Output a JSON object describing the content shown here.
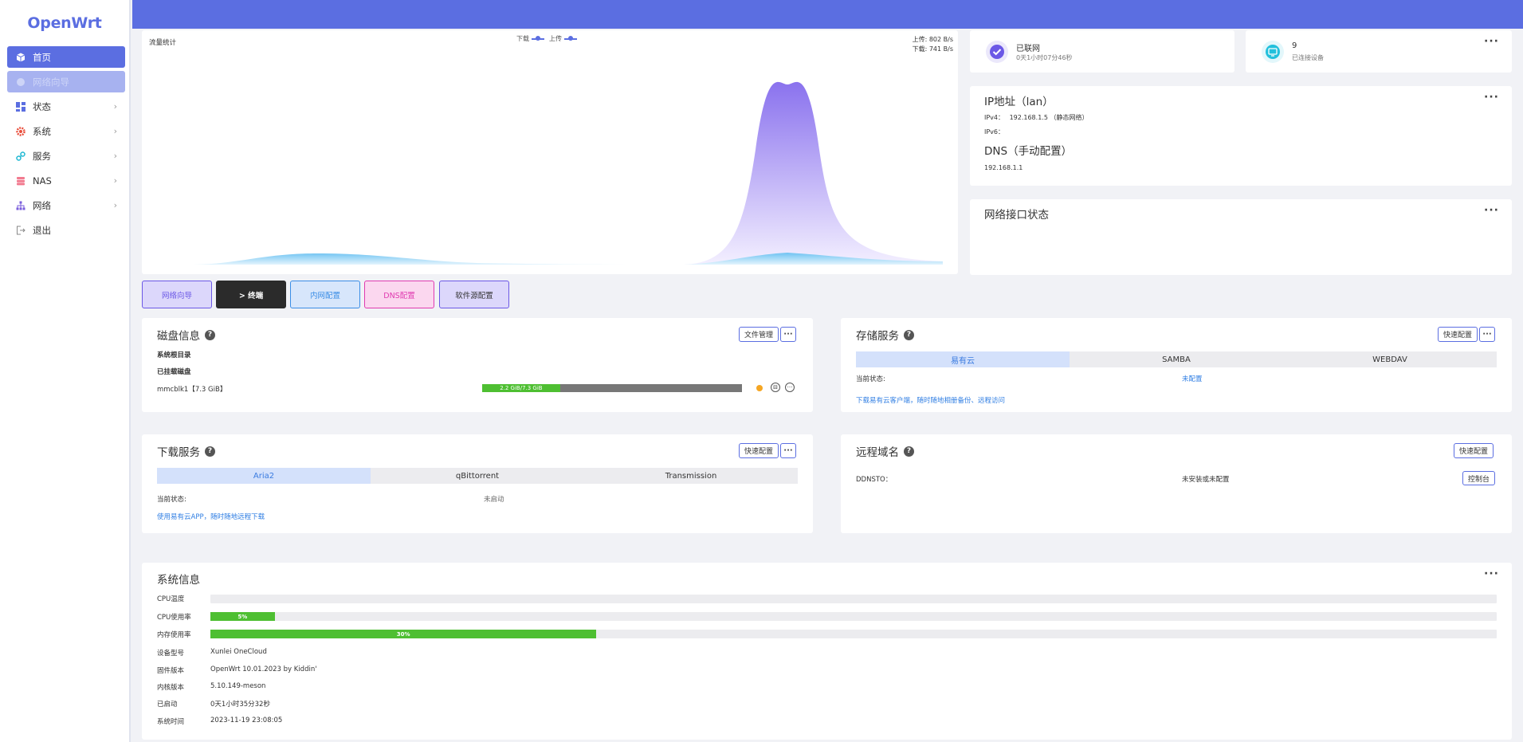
{
  "brand": "OpenWrt",
  "sidebar": {
    "items": [
      {
        "label": "首页",
        "icon": "cube-icon"
      },
      {
        "label": "网络向导",
        "icon": "wizard-icon"
      },
      {
        "label": "状态",
        "icon": "dashboard-icon"
      },
      {
        "label": "系统",
        "icon": "gear-icon"
      },
      {
        "label": "服务",
        "icon": "link-icon"
      },
      {
        "label": "NAS",
        "icon": "database-icon"
      },
      {
        "label": "网络",
        "icon": "network-icon"
      },
      {
        "label": "退出",
        "icon": "logout-icon"
      }
    ]
  },
  "traffic": {
    "title": "流量统计",
    "legend_down": "下载",
    "legend_up": "上传",
    "upload_rate": "上传: 802 B/s",
    "download_rate": "下载: 741 B/s"
  },
  "network_status": {
    "label": "已联网",
    "uptime": "0天1小时07分46秒"
  },
  "devices": {
    "count": "9",
    "label": "已连接设备"
  },
  "ip": {
    "title": "IP地址（lan）",
    "ipv4_label": "IPv4：",
    "ipv4_value": "192.168.1.5 （静态网络）",
    "ipv6_label": "IPv6：",
    "dns_title": "DNS（手动配置）",
    "dns_value": "192.168.1.1"
  },
  "interfaces": {
    "title": "网络接口状态"
  },
  "quick_buttons": [
    "网络向导",
    "> 终端",
    "内网配置",
    "DNS配置",
    "软件源配置"
  ],
  "disk": {
    "title": "磁盘信息",
    "file_btn": "文件管理",
    "sys_root": "系统根目录",
    "mounted": "已挂载磁盘",
    "device": "mmcblk1【7.3 GiB】",
    "usage_text": "2.2 GiB/7.3 GiB",
    "usage_fraction": 0.3
  },
  "storage": {
    "title": "存储服务",
    "quick_btn": "快速配置",
    "tabs": [
      "易有云",
      "SAMBA",
      "WEBDAV"
    ],
    "status_label": "当前状态:",
    "status_value": "未配置",
    "link": "下载易有云客户端，随时随地相册备份、远程访问"
  },
  "download": {
    "title": "下载服务",
    "quick_btn": "快速配置",
    "tabs": [
      "Aria2",
      "qBittorrent",
      "Transmission"
    ],
    "status_label": "当前状态:",
    "status_value": "未启动",
    "link": "使用易有云APP，随时随地远程下载"
  },
  "remote": {
    "title": "远程域名",
    "quick_btn": "快速配置",
    "ddnsto_label": "DDNSTO：",
    "ddnsto_value": "未安装或未配置",
    "console_btn": "控制台"
  },
  "system": {
    "title": "系统信息",
    "cpu_temp_label": "CPU温度",
    "cpu_usage_label": "CPU使用率",
    "cpu_usage": "5%",
    "cpu_usage_pct": 5,
    "mem_usage_label": "内存使用率",
    "mem_usage": "30%",
    "mem_usage_pct": 30,
    "model_label": "设备型号",
    "model": "Xunlei OneCloud",
    "firmware_label": "固件版本",
    "firmware": "OpenWrt 10.01.2023 by Kiddin'",
    "kernel_label": "内核版本",
    "kernel": "5.10.149-meson",
    "uptime_label": "已启动",
    "uptime": "0天1小时35分32秒",
    "time_label": "系统时间",
    "time": "2023-11-19 23:08:05"
  },
  "colors": {
    "accent": "#5b6ee1",
    "green": "#4ebf32",
    "link": "#2f7ee3"
  }
}
